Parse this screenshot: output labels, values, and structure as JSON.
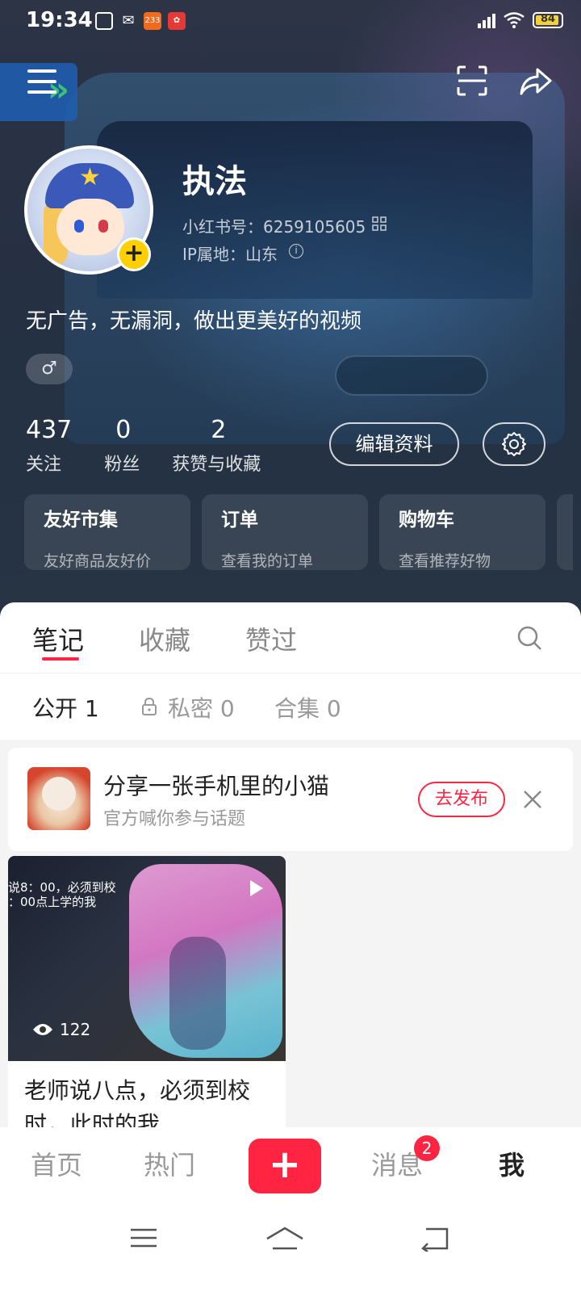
{
  "status_bar": {
    "time": "19:34",
    "battery": "84",
    "notif_icons": [
      "qr-scan-icon",
      "wechat-icon",
      "app-233-icon",
      "app-red-icon"
    ],
    "app_233_label": "233"
  },
  "toolbar": {
    "menu_icon": "menu-icon",
    "scan_icon": "scan-icon",
    "share_icon": "share-icon"
  },
  "profile": {
    "nickname": "执法",
    "user_id": "小红书号：6259105605",
    "ip_location": "IP属地：山东",
    "bio": "无广告，无漏洞，做出更美好的视频",
    "gender_symbol": "♂",
    "avatar_add": "+"
  },
  "stats": [
    {
      "value": "437",
      "label": "关注"
    },
    {
      "value": "0",
      "label": "粉丝"
    },
    {
      "value": "2",
      "label": "获赞与收藏"
    }
  ],
  "actions": {
    "edit_profile": "编辑资料"
  },
  "cards": [
    {
      "title": "友好市集",
      "subtitle": "友好商品友好价"
    },
    {
      "title": "订单",
      "subtitle": "查看我的订单"
    },
    {
      "title": "购物车",
      "subtitle": "查看推荐好物"
    }
  ],
  "tabs": [
    "笔记",
    "收藏",
    "赞过"
  ],
  "subtabs": [
    "公开 1",
    "私密 0",
    "合集 0"
  ],
  "topic": {
    "title": "分享一张手机里的小猫",
    "subtitle": "官方喊你参与话题",
    "button": "去发布"
  },
  "note": {
    "cover_text": "说8：00，必须到校\n：00点上学的我",
    "views": "122",
    "title": "老师说八点，必须到校时，此时的我"
  },
  "bottom_nav": {
    "home": "首页",
    "hot": "热门",
    "post": "+",
    "messages": "消息",
    "message_badge": "2",
    "me": "我"
  },
  "colors": {
    "accent": "#ff2442",
    "avatar_add": "#ffd000"
  }
}
